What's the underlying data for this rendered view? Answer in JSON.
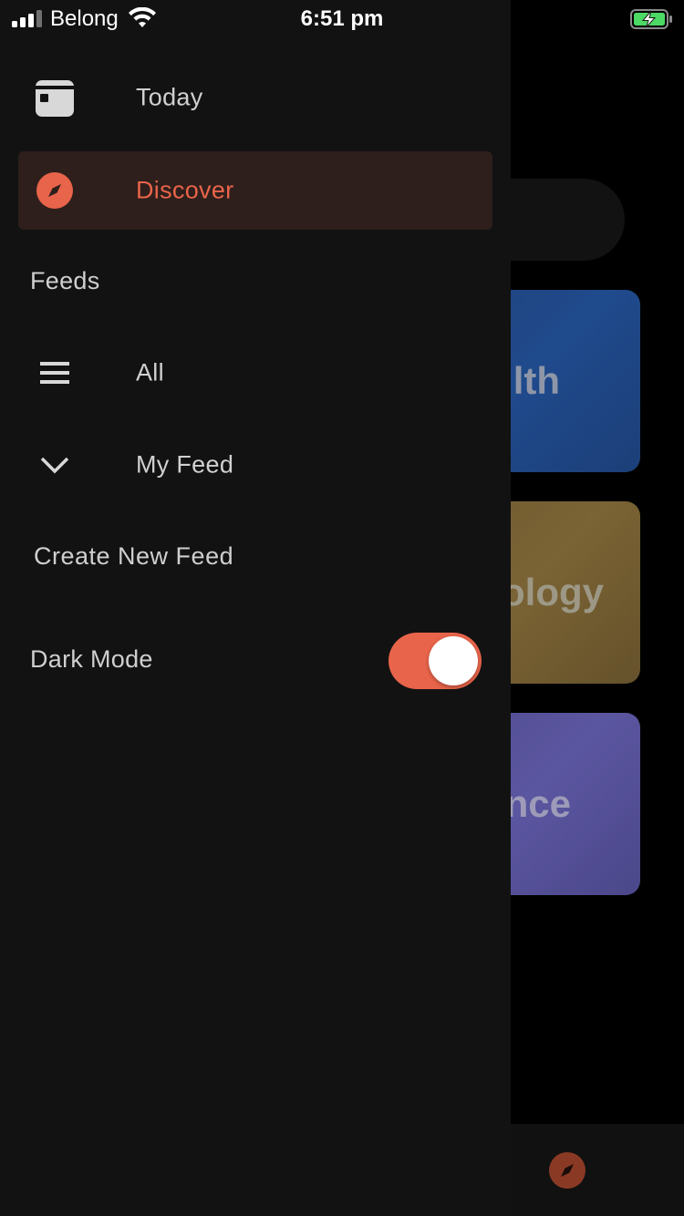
{
  "status_bar": {
    "carrier": "Belong",
    "time": "6:51 pm",
    "signal_bars": 3,
    "signal_bars_total": 4,
    "battery_state": "charging",
    "battery_color": "#4cd964"
  },
  "background": {
    "cards": [
      {
        "label": "lth"
      },
      {
        "label": "ology"
      },
      {
        "label": "nce"
      }
    ]
  },
  "drawer": {
    "items": [
      {
        "label": "Today",
        "icon": "calendar-icon",
        "active": false
      },
      {
        "label": "Discover",
        "icon": "compass-icon",
        "active": true
      }
    ],
    "feeds_heading": "Feeds",
    "feeds": [
      {
        "label": "All",
        "icon": "menu-icon"
      },
      {
        "label": "My Feed",
        "icon": "chevron-down-icon"
      }
    ],
    "create_feed_label": "Create New Feed",
    "dark_mode": {
      "label": "Dark Mode",
      "enabled": true
    }
  },
  "colors": {
    "accent": "#e8644a",
    "active_bg": "#2e1f1c",
    "drawer_bg": "#121212"
  }
}
